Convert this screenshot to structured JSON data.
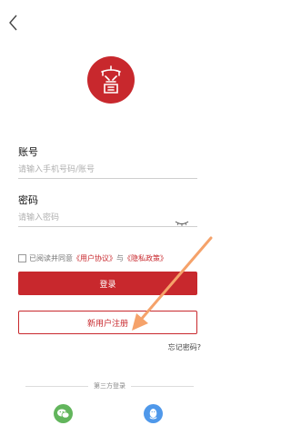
{
  "nav": {
    "back_icon": "chevron-left-icon"
  },
  "logo": {
    "icon": "seal-logo-icon",
    "color": "#c8282d"
  },
  "account": {
    "label": "账号",
    "placeholder": "请输入手机号码/账号"
  },
  "password": {
    "label": "密码",
    "placeholder": "请输入密码",
    "toggle_icon": "eye-closed-icon"
  },
  "agreement": {
    "prefix": "已阅读并同意",
    "user_agreement": "《用户协议》",
    "joiner": "与",
    "privacy_policy": "《隐私政策》"
  },
  "buttons": {
    "login": "登录",
    "register": "新用户注册"
  },
  "forgot_password": "忘记密码?",
  "third_party": {
    "title": "第三方登录",
    "wechat_icon": "wechat-icon",
    "qq_icon": "qq-icon"
  },
  "annotation": {
    "icon": "arrow-icon",
    "color": "#f5a26a"
  },
  "colors": {
    "primary": "#c8282d",
    "wechat": "#62b55c",
    "qq": "#4f98ea"
  }
}
